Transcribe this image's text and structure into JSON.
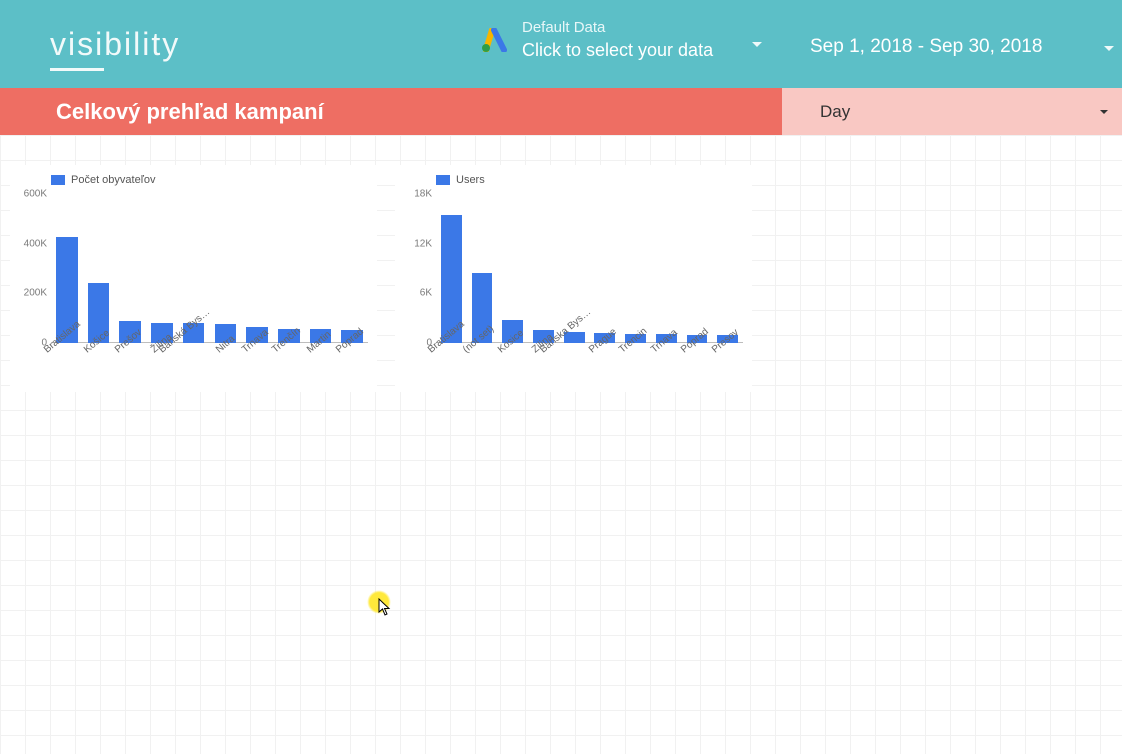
{
  "brand": {
    "part1": "visi",
    "part2": "bility"
  },
  "datasource": {
    "line1": "Default Data",
    "line2": "Click to select your data"
  },
  "date_range": "Sep 1, 2018 - Sep 30, 2018",
  "section_title": "Celkový prehľad kampaní",
  "granularity": "Day",
  "chart_data": [
    {
      "type": "bar",
      "title": "",
      "legend": "Počet obyvateľov",
      "xlabel": "",
      "ylabel": "",
      "ylim": [
        0,
        600000
      ],
      "yticks": [
        0,
        200000,
        400000,
        600000
      ],
      "ytick_labels": [
        "0",
        "200K",
        "400K",
        "600K"
      ],
      "categories": [
        "Bratislava",
        "Košice",
        "Prešov",
        "Žilina",
        "Banská Bys…",
        "Nitra",
        "Trnava",
        "Trenčín",
        "Martin",
        "Poprad"
      ],
      "values": [
        425000,
        240000,
        90000,
        82000,
        80000,
        78000,
        66000,
        58000,
        56000,
        52000
      ]
    },
    {
      "type": "bar",
      "title": "",
      "legend": "Users",
      "xlabel": "",
      "ylabel": "",
      "ylim": [
        0,
        18000
      ],
      "yticks": [
        0,
        6000,
        12000,
        18000
      ],
      "ytick_labels": [
        "0",
        "6K",
        "12K",
        "18K"
      ],
      "categories": [
        "Bratislava",
        "(not set)",
        "Kosice",
        "Zilina",
        "Banska Bys…",
        "Prague",
        "Trencin",
        "Trnava",
        "Poprad",
        "Presov"
      ],
      "values": [
        15500,
        8500,
        2800,
        1600,
        1300,
        1200,
        1100,
        1050,
        1000,
        950
      ]
    }
  ]
}
